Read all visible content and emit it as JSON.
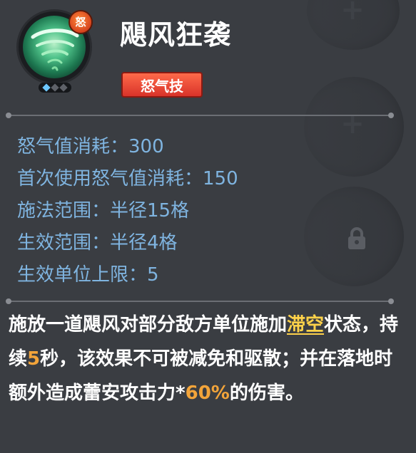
{
  "skill": {
    "name": "飓风狂袭",
    "type_label": "怒气技",
    "rage_badge": "怒",
    "icon": "tornado-icon",
    "star_dots": 3,
    "active_dots": 1
  },
  "stats": [
    {
      "label": "怒气值消耗：",
      "value": "300"
    },
    {
      "label": "首次使用怒气值消耗：",
      "value": "150"
    },
    {
      "label": "施法范围：",
      "value": "半径15格"
    },
    {
      "label": "生效范围：",
      "value": "半径4格"
    },
    {
      "label": "生效单位上限：",
      "value": "5"
    }
  ],
  "description": {
    "part1": "施放一道飓风对部分敌方单位施加",
    "keyword": "滞空",
    "part2": "状态，持续",
    "duration": "5",
    "part3": "秒，该效果不可被减免和驱散；并在落地时额外造成蕾安攻击力*",
    "ratio": "60%",
    "part4": "的伤害。"
  },
  "colors": {
    "stat_text": "#7fb4e0",
    "keyword": "#ffd24a",
    "number_highlight": "#f2a43a",
    "type_badge": "#d8332a"
  }
}
